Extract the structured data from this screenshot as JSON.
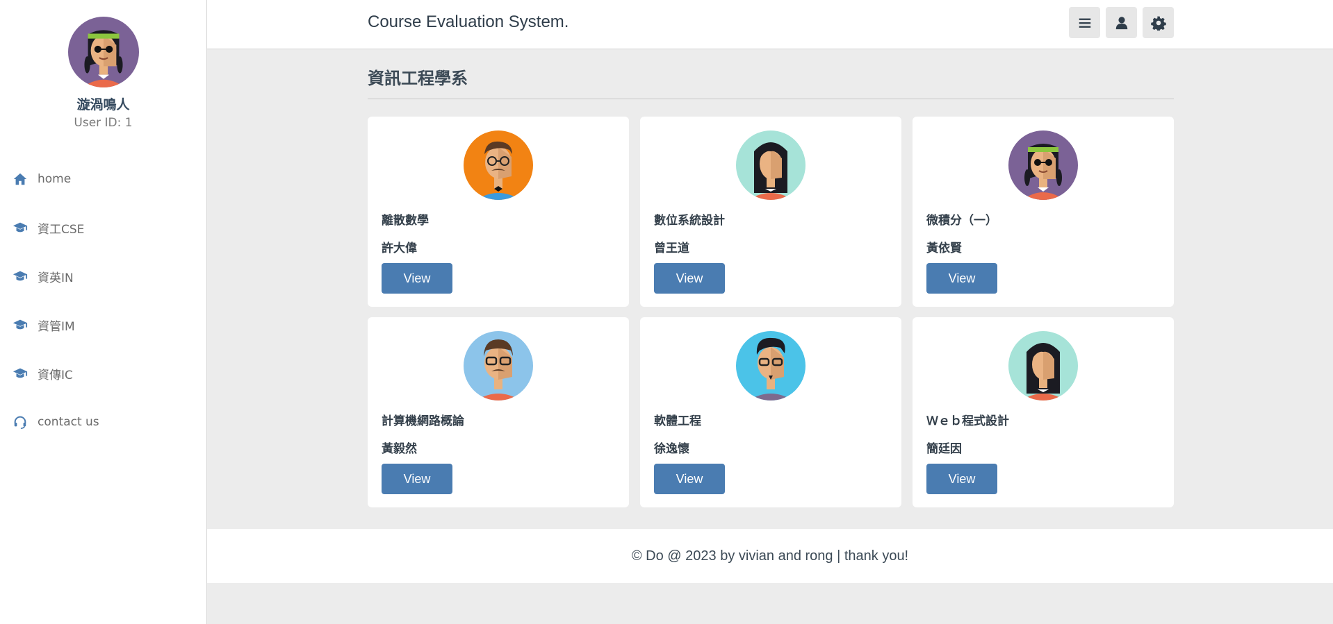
{
  "app": {
    "title": "Course Evaluation System."
  },
  "user": {
    "name": "漩渦鳴人",
    "id_label": "User ID: 1",
    "avatar": "avatar-girl-headband-sunglasses"
  },
  "header_icons": [
    "menu-icon",
    "user-icon",
    "gear-icon"
  ],
  "colors": {
    "accent": "#4a7cb1",
    "background": "#ececec",
    "card": "#ffffff"
  },
  "nav": {
    "items": [
      {
        "label": "home",
        "icon": "home-icon"
      },
      {
        "label": "資工CSE",
        "icon": "graduation-cap-icon"
      },
      {
        "label": "資英IN",
        "icon": "graduation-cap-icon"
      },
      {
        "label": "資管IM",
        "icon": "graduation-cap-icon"
      },
      {
        "label": "資傳IC",
        "icon": "graduation-cap-icon"
      },
      {
        "label": "contact us",
        "icon": "headset-icon"
      }
    ]
  },
  "main": {
    "section_title": "資訊工程學系",
    "cards": [
      {
        "course": "離散數學",
        "teacher": "許大偉",
        "button": "View",
        "avatar": "avatar-man-glasses-mustache-orange"
      },
      {
        "course": "數位系統設計",
        "teacher": "曾王道",
        "button": "View",
        "avatar": "avatar-woman-long-hair-teal"
      },
      {
        "course": "微積分（一）",
        "teacher": "黃依賢",
        "button": "View",
        "avatar": "avatar-girl-headband-sunglasses"
      },
      {
        "course": "計算機網路概論",
        "teacher": "黃毅然",
        "button": "View",
        "avatar": "avatar-man-glasses-mustache-blue"
      },
      {
        "course": "軟體工程",
        "teacher": "徐逸懷",
        "button": "View",
        "avatar": "avatar-man-glasses-goatee-cyan"
      },
      {
        "course": "Ｗｅｂ程式設計",
        "teacher": "簡廷因",
        "button": "View",
        "avatar": "avatar-woman-long-hair-teal"
      }
    ]
  },
  "footer": {
    "text": "© Do @ 2023 by vivian and rong | thank you!"
  }
}
